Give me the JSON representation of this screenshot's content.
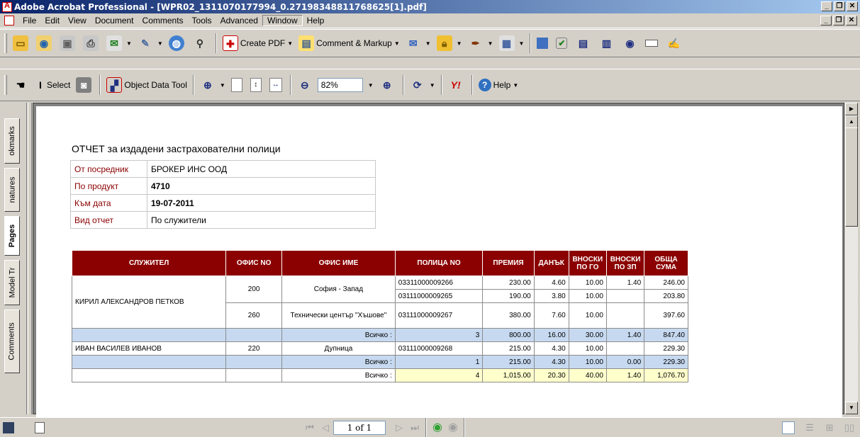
{
  "window": {
    "title": "Adobe Acrobat Professional - [WPR02_1311070177994_0.27198348811768625[1].pdf]"
  },
  "menu": {
    "items": [
      "File",
      "Edit",
      "View",
      "Document",
      "Comments",
      "Tools",
      "Advanced",
      "Window",
      "Help"
    ]
  },
  "toolbar1": {
    "create_pdf": "Create PDF",
    "comment_markup": "Comment & Markup"
  },
  "toolbar2": {
    "select": "Select",
    "object_data_tool": "Object Data Tool",
    "zoom_value": "82%",
    "help": "Help"
  },
  "nav_panel": {
    "tabs": [
      "Bookmarks",
      "Signatures",
      "Pages",
      "Model Tree",
      "Comments"
    ],
    "tab_visible_labels": [
      "okmarks",
      "natures",
      "Pages",
      "Model Tr",
      "Comments"
    ]
  },
  "report": {
    "title": "ОТЧЕТ за издадени застрахователни полици",
    "info": [
      {
        "label": "От посредник",
        "value": "БРОКЕР ИНС ООД",
        "bold": false
      },
      {
        "label": "По продукт",
        "value": "4710",
        "bold": true
      },
      {
        "label": "Към дата",
        "value": "19-07-2011",
        "bold": true
      },
      {
        "label": "Вид отчет",
        "value": "По служители",
        "bold": false
      }
    ],
    "columns": [
      "СЛУЖИТЕЛ",
      "ОФИС NO",
      "ОФИС ИМЕ",
      "ПОЛИЦА NO",
      "ПРЕМИЯ",
      "ДАНЪК",
      "ВНОСКИ ПО ГО",
      "ВНОСКИ ПО ЗП",
      "ОБЩА СУМА"
    ],
    "employee1": {
      "name": "КИРИЛ АЛЕКСАНДРОВ ПЕТКОВ",
      "office1_no": "200",
      "office1_name": "София - Запад",
      "office2_no": "260",
      "office2_name": "Технически център \"Хъшове\"",
      "rows": [
        {
          "policy": "03311000009266",
          "premium": "230.00",
          "tax": "4.60",
          "go": "10.00",
          "zp": "1.40",
          "total": "246.00"
        },
        {
          "policy": "03111000009265",
          "premium": "190.00",
          "tax": "3.80",
          "go": "10.00",
          "zp": "",
          "total": "203.80"
        },
        {
          "policy": "03111000009267",
          "premium": "380.00",
          "tax": "7.60",
          "go": "10.00",
          "zp": "",
          "total": "397.60"
        }
      ],
      "subtotal": {
        "label": "Всичко :",
        "count": "3",
        "premium": "800.00",
        "tax": "16.00",
        "go": "30.00",
        "zp": "1.40",
        "total": "847.40"
      }
    },
    "employee2": {
      "name": "ИВАН ВАСИЛЕВ ИВАНОВ",
      "office_no": "220",
      "office_name": "Дупница",
      "rows": [
        {
          "policy": "03111000009268",
          "premium": "215.00",
          "tax": "4.30",
          "go": "10.00",
          "zp": "",
          "total": "229.30"
        }
      ],
      "subtotal": {
        "label": "Всичко :",
        "count": "1",
        "premium": "215.00",
        "tax": "4.30",
        "go": "10.00",
        "zp": "0.00",
        "total": "229.30"
      }
    },
    "grand_total": {
      "label": "Всичко :",
      "count": "4",
      "premium": "1,015.00",
      "tax": "20.30",
      "go": "40.00",
      "zp": "1.40",
      "total": "1,076.70"
    }
  },
  "statusbar": {
    "page_indicator": "1 of 1"
  },
  "colors": {
    "header_bg": "#8b0000",
    "subtotal_bg": "#c6d9f0",
    "total_bg": "#ffffcc",
    "label_color": "#8b0000"
  }
}
